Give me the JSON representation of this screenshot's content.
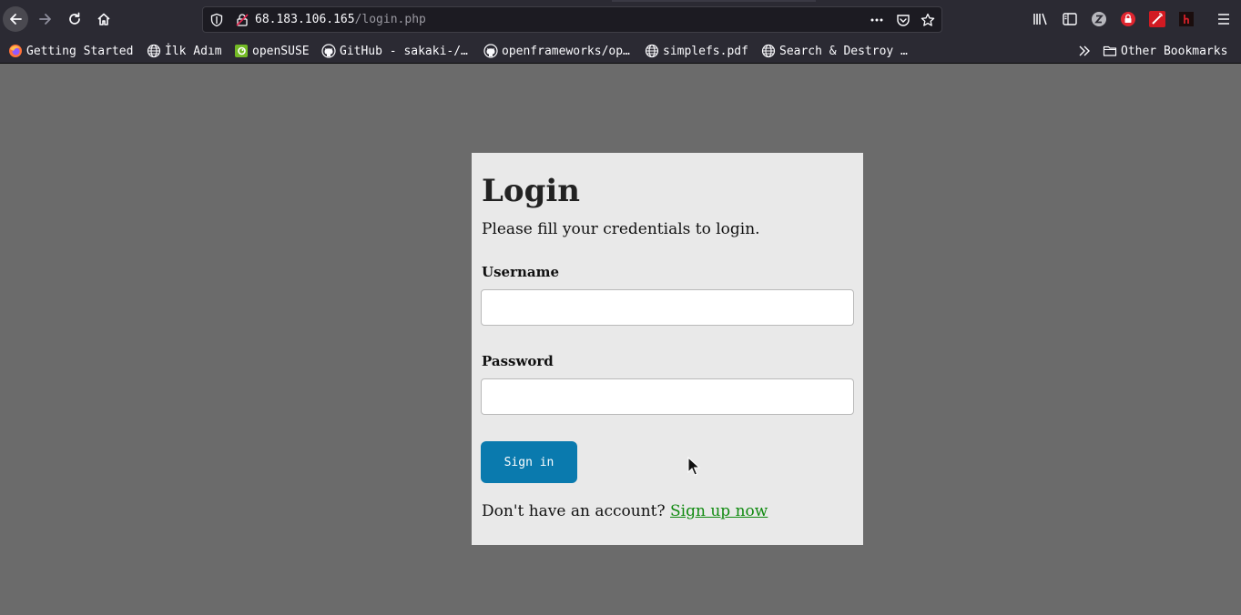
{
  "browser": {
    "url_host": "68.183.106.165",
    "url_path": "/login.php",
    "bookmarks": [
      {
        "label": "Getting Started",
        "icon": "firefox-icon"
      },
      {
        "label": "İlk Adım",
        "icon": "globe-icon"
      },
      {
        "label": "openSUSE",
        "icon": "opensuse-icon"
      },
      {
        "label": "GitHub - sakaki-/…",
        "icon": "github-icon"
      },
      {
        "label": "openframeworks/op…",
        "icon": "github-icon"
      },
      {
        "label": "simplefs.pdf",
        "icon": "globe-icon"
      },
      {
        "label": "Search & Destroy …",
        "icon": "globe-icon"
      }
    ],
    "other_bookmarks": "Other Bookmarks"
  },
  "login": {
    "title": "Login",
    "subtitle": "Please fill your credentials to login.",
    "username_label": "Username",
    "username_value": "",
    "password_label": "Password",
    "password_value": "",
    "submit_label": "Sign in",
    "signup_prompt": "Don't have an account?",
    "signup_link": "Sign up now"
  },
  "colors": {
    "page_bg": "#6b6b6b",
    "panel_bg": "#e9e9e9",
    "button_bg": "#0a7aae",
    "link": "#108a10"
  }
}
